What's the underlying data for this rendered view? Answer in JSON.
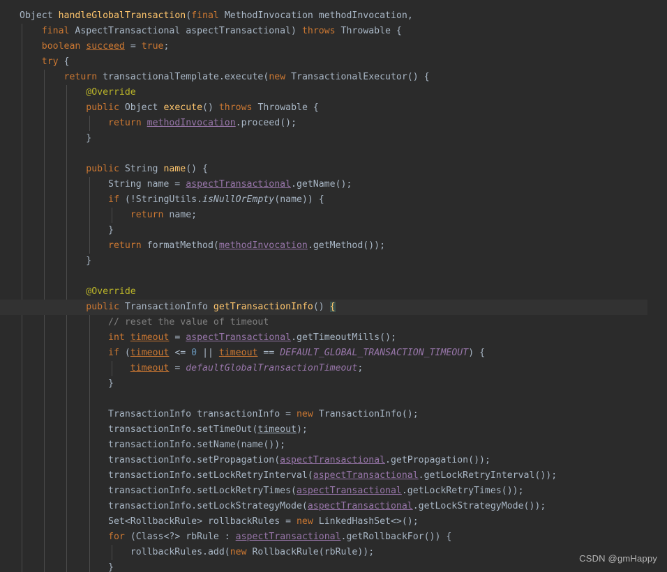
{
  "editor": {
    "background": "#2b2b2b",
    "current_line_background": "#323232",
    "guide_color": "#4b4b4b",
    "default_text_color": "#a9b7c6",
    "keyword_color": "#cc7832",
    "method_color": "#ffc66d",
    "annotation_color": "#bbb529",
    "comment_color": "#808080",
    "field_color": "#9876aa",
    "number_color": "#6897bb",
    "brace_match_background": "#3b514d",
    "language": "Java",
    "current_line_number": 20,
    "indent_guide_x": [
      31,
      63,
      95,
      128,
      160,
      192
    ],
    "line_height": 22,
    "char_width": 8
  },
  "watermark": {
    "text": "CSDN @gmHappy"
  },
  "code": {
    "lines": [
      "Object handleGlobalTransaction(final MethodInvocation methodInvocation,",
      "    final AspectTransactional aspectTransactional) throws Throwable {",
      "    boolean succeed = true;",
      "    try {",
      "        return transactionalTemplate.execute(new TransactionalExecutor() {",
      "            @Override",
      "            public Object execute() throws Throwable {",
      "                return methodInvocation.proceed();",
      "            }",
      "",
      "            public String name() {",
      "                String name = aspectTransactional.getName();",
      "                if (!StringUtils.isNullOrEmpty(name)) {",
      "                    return name;",
      "                }",
      "                return formatMethod(methodInvocation.getMethod());",
      "            }",
      "",
      "            @Override",
      "            public TransactionInfo getTransactionInfo() {",
      "                // reset the value of timeout",
      "                int timeout = aspectTransactional.getTimeoutMills();",
      "                if (timeout <= 0 || timeout == DEFAULT_GLOBAL_TRANSACTION_TIMEOUT) {",
      "                    timeout = defaultGlobalTransactionTimeout;",
      "                }",
      "",
      "                TransactionInfo transactionInfo = new TransactionInfo();",
      "                transactionInfo.setTimeOut(timeout);",
      "                transactionInfo.setName(name());",
      "                transactionInfo.setPropagation(aspectTransactional.getPropagation());",
      "                transactionInfo.setLockRetryInterval(aspectTransactional.getLockRetryInterval());",
      "                transactionInfo.setLockRetryTimes(aspectTransactional.getLockRetryTimes());",
      "                transactionInfo.setLockStrategyMode(aspectTransactional.getLockStrategyMode());",
      "                Set<RollbackRule> rollbackRules = new LinkedHashSet<>();",
      "                for (Class<?> rbRule : aspectTransactional.getRollbackFor()) {",
      "                    rollbackRules.add(new RollbackRule(rbRule));",
      "                }"
    ],
    "tokens": [
      [
        {
          "t": "Object",
          "c": "pln"
        },
        {
          "t": " ",
          "c": "pln"
        },
        {
          "t": "handleGlobalTransaction",
          "c": "mth"
        },
        {
          "t": "(",
          "c": "pln"
        },
        {
          "t": "final",
          "c": "kw"
        },
        {
          "t": " MethodInvocation methodInvocation,",
          "c": "pln"
        }
      ],
      [
        {
          "t": "    ",
          "c": "pln"
        },
        {
          "t": "final",
          "c": "kw"
        },
        {
          "t": " AspectTransactional aspectTransactional) ",
          "c": "pln"
        },
        {
          "t": "throws",
          "c": "kw"
        },
        {
          "t": " Throwable {",
          "c": "pln"
        }
      ],
      [
        {
          "t": "    ",
          "c": "pln"
        },
        {
          "t": "boolean",
          "c": "kw"
        },
        {
          "t": " ",
          "c": "pln"
        },
        {
          "t": "succeed",
          "c": "lvaro"
        },
        {
          "t": " = ",
          "c": "pln"
        },
        {
          "t": "true",
          "c": "kw"
        },
        {
          "t": ";",
          "c": "pln"
        }
      ],
      [
        {
          "t": "    ",
          "c": "pln"
        },
        {
          "t": "try",
          "c": "kw"
        },
        {
          "t": " {",
          "c": "pln"
        }
      ],
      [
        {
          "t": "        ",
          "c": "pln"
        },
        {
          "t": "return",
          "c": "kw"
        },
        {
          "t": " transactionalTemplate.execute(",
          "c": "pln"
        },
        {
          "t": "new",
          "c": "kw"
        },
        {
          "t": " TransactionalExecutor() {",
          "c": "pln"
        }
      ],
      [
        {
          "t": "            ",
          "c": "pln"
        },
        {
          "t": "@Override",
          "c": "anno"
        }
      ],
      [
        {
          "t": "            ",
          "c": "pln"
        },
        {
          "t": "public",
          "c": "kw"
        },
        {
          "t": " Object ",
          "c": "pln"
        },
        {
          "t": "execute",
          "c": "mth"
        },
        {
          "t": "() ",
          "c": "pln"
        },
        {
          "t": "throws",
          "c": "kw"
        },
        {
          "t": " Throwable {",
          "c": "pln"
        }
      ],
      [
        {
          "t": "                ",
          "c": "pln"
        },
        {
          "t": "return",
          "c": "kw"
        },
        {
          "t": " ",
          "c": "pln"
        },
        {
          "t": "methodInvocation",
          "c": "fld"
        },
        {
          "t": ".proceed();",
          "c": "pln"
        }
      ],
      [
        {
          "t": "            }",
          "c": "pln"
        }
      ],
      [
        {
          "t": "",
          "c": "pln"
        }
      ],
      [
        {
          "t": "            ",
          "c": "pln"
        },
        {
          "t": "public",
          "c": "kw"
        },
        {
          "t": " String ",
          "c": "pln"
        },
        {
          "t": "name",
          "c": "mth"
        },
        {
          "t": "() {",
          "c": "pln"
        }
      ],
      [
        {
          "t": "                String name = ",
          "c": "pln"
        },
        {
          "t": "aspectTransactional",
          "c": "fld"
        },
        {
          "t": ".getName();",
          "c": "pln"
        }
      ],
      [
        {
          "t": "                ",
          "c": "pln"
        },
        {
          "t": "if",
          "c": "kw"
        },
        {
          "t": " (!StringUtils.",
          "c": "pln"
        },
        {
          "t": "isNullOrEmpty",
          "c": "smth"
        },
        {
          "t": "(name)) {",
          "c": "pln"
        }
      ],
      [
        {
          "t": "                    ",
          "c": "pln"
        },
        {
          "t": "return",
          "c": "kw"
        },
        {
          "t": " name;",
          "c": "pln"
        }
      ],
      [
        {
          "t": "                }",
          "c": "pln"
        }
      ],
      [
        {
          "t": "                ",
          "c": "pln"
        },
        {
          "t": "return",
          "c": "kw"
        },
        {
          "t": " formatMethod(",
          "c": "pln"
        },
        {
          "t": "methodInvocation",
          "c": "fld"
        },
        {
          "t": ".getMethod());",
          "c": "pln"
        }
      ],
      [
        {
          "t": "            }",
          "c": "pln"
        }
      ],
      [
        {
          "t": "",
          "c": "pln"
        }
      ],
      [
        {
          "t": "            ",
          "c": "pln"
        },
        {
          "t": "@Override",
          "c": "anno"
        }
      ],
      [
        {
          "t": "            ",
          "c": "pln"
        },
        {
          "t": "public",
          "c": "kw"
        },
        {
          "t": " TransactionInfo ",
          "c": "pln"
        },
        {
          "t": "getTransactionInfo",
          "c": "mth"
        },
        {
          "t": "() ",
          "c": "pln"
        },
        {
          "t": "{",
          "c": "brace-hl"
        }
      ],
      [
        {
          "t": "                ",
          "c": "pln"
        },
        {
          "t": "// reset the value of timeout",
          "c": "cmt"
        }
      ],
      [
        {
          "t": "                ",
          "c": "pln"
        },
        {
          "t": "int",
          "c": "kw"
        },
        {
          "t": " ",
          "c": "pln"
        },
        {
          "t": "timeout",
          "c": "lvaro"
        },
        {
          "t": " = ",
          "c": "pln"
        },
        {
          "t": "aspectTransactional",
          "c": "fld"
        },
        {
          "t": ".getTimeoutMills();",
          "c": "pln"
        }
      ],
      [
        {
          "t": "                ",
          "c": "pln"
        },
        {
          "t": "if",
          "c": "kw"
        },
        {
          "t": " (",
          "c": "pln"
        },
        {
          "t": "timeout",
          "c": "lvaro"
        },
        {
          "t": " <= ",
          "c": "pln"
        },
        {
          "t": "0",
          "c": "num"
        },
        {
          "t": " || ",
          "c": "pln"
        },
        {
          "t": "timeout",
          "c": "lvaro"
        },
        {
          "t": " == ",
          "c": "pln"
        },
        {
          "t": "DEFAULT_GLOBAL_TRANSACTION_TIMEOUT",
          "c": "sfld"
        },
        {
          "t": ") {",
          "c": "pln"
        }
      ],
      [
        {
          "t": "                    ",
          "c": "pln"
        },
        {
          "t": "timeout",
          "c": "lvaro"
        },
        {
          "t": " = ",
          "c": "pln"
        },
        {
          "t": "defaultGlobalTransactionTimeout",
          "c": "sfld"
        },
        {
          "t": ";",
          "c": "pln"
        }
      ],
      [
        {
          "t": "                }",
          "c": "pln"
        }
      ],
      [
        {
          "t": "",
          "c": "pln"
        }
      ],
      [
        {
          "t": "                TransactionInfo transactionInfo = ",
          "c": "pln"
        },
        {
          "t": "new",
          "c": "kw"
        },
        {
          "t": " TransactionInfo();",
          "c": "pln"
        }
      ],
      [
        {
          "t": "                transactionInfo.setTimeOut(",
          "c": "pln"
        },
        {
          "t": "timeout",
          "c": "lvar"
        },
        {
          "t": ");",
          "c": "pln"
        }
      ],
      [
        {
          "t": "                transactionInfo.setName(name());",
          "c": "pln"
        }
      ],
      [
        {
          "t": "                transactionInfo.setPropagation(",
          "c": "pln"
        },
        {
          "t": "aspectTransactional",
          "c": "fld"
        },
        {
          "t": ".getPropagation());",
          "c": "pln"
        }
      ],
      [
        {
          "t": "                transactionInfo.setLockRetryInterval(",
          "c": "pln"
        },
        {
          "t": "aspectTransactional",
          "c": "fld"
        },
        {
          "t": ".getLockRetryInterval());",
          "c": "pln"
        }
      ],
      [
        {
          "t": "                transactionInfo.setLockRetryTimes(",
          "c": "pln"
        },
        {
          "t": "aspectTransactional",
          "c": "fld"
        },
        {
          "t": ".getLockRetryTimes());",
          "c": "pln"
        }
      ],
      [
        {
          "t": "                transactionInfo.setLockStrategyMode(",
          "c": "pln"
        },
        {
          "t": "aspectTransactional",
          "c": "fld"
        },
        {
          "t": ".getLockStrategyMode());",
          "c": "pln"
        }
      ],
      [
        {
          "t": "                Set<RollbackRule> rollbackRules = ",
          "c": "pln"
        },
        {
          "t": "new",
          "c": "kw"
        },
        {
          "t": " LinkedHashSet<>();",
          "c": "pln"
        }
      ],
      [
        {
          "t": "                ",
          "c": "pln"
        },
        {
          "t": "for",
          "c": "kw"
        },
        {
          "t": " (Class<?> rbRule : ",
          "c": "pln"
        },
        {
          "t": "aspectTransactional",
          "c": "fld"
        },
        {
          "t": ".getRollbackFor()) {",
          "c": "pln"
        }
      ],
      [
        {
          "t": "                    rollbackRules.add(",
          "c": "pln"
        },
        {
          "t": "new",
          "c": "kw"
        },
        {
          "t": " RollbackRule(rbRule));",
          "c": "pln"
        }
      ],
      [
        {
          "t": "                }",
          "c": "pln"
        }
      ]
    ],
    "current_line_index": 19,
    "guides_per_line": [
      [],
      [
        31
      ],
      [
        31
      ],
      [
        31
      ],
      [
        31,
        63
      ],
      [
        31,
        63,
        95
      ],
      [
        31,
        63,
        95
      ],
      [
        31,
        63,
        95,
        128
      ],
      [
        31,
        63,
        95
      ],
      [
        31,
        63,
        95
      ],
      [
        31,
        63,
        95
      ],
      [
        31,
        63,
        95,
        128
      ],
      [
        31,
        63,
        95,
        128
      ],
      [
        31,
        63,
        95,
        128,
        160
      ],
      [
        31,
        63,
        95,
        128
      ],
      [
        31,
        63,
        95,
        128
      ],
      [
        31,
        63,
        95
      ],
      [
        31,
        63,
        95
      ],
      [
        31,
        63,
        95
      ],
      [
        31,
        63,
        95
      ],
      [
        31,
        63,
        95,
        128
      ],
      [
        31,
        63,
        95,
        128
      ],
      [
        31,
        63,
        95,
        128
      ],
      [
        31,
        63,
        95,
        128,
        160
      ],
      [
        31,
        63,
        95,
        128
      ],
      [
        31,
        63,
        95,
        128
      ],
      [
        31,
        63,
        95,
        128
      ],
      [
        31,
        63,
        95,
        128
      ],
      [
        31,
        63,
        95,
        128
      ],
      [
        31,
        63,
        95,
        128
      ],
      [
        31,
        63,
        95,
        128
      ],
      [
        31,
        63,
        95,
        128
      ],
      [
        31,
        63,
        95,
        128
      ],
      [
        31,
        63,
        95,
        128
      ],
      [
        31,
        63,
        95,
        128
      ],
      [
        31,
        63,
        95,
        128,
        160
      ],
      [
        31,
        63,
        95,
        128
      ]
    ]
  }
}
